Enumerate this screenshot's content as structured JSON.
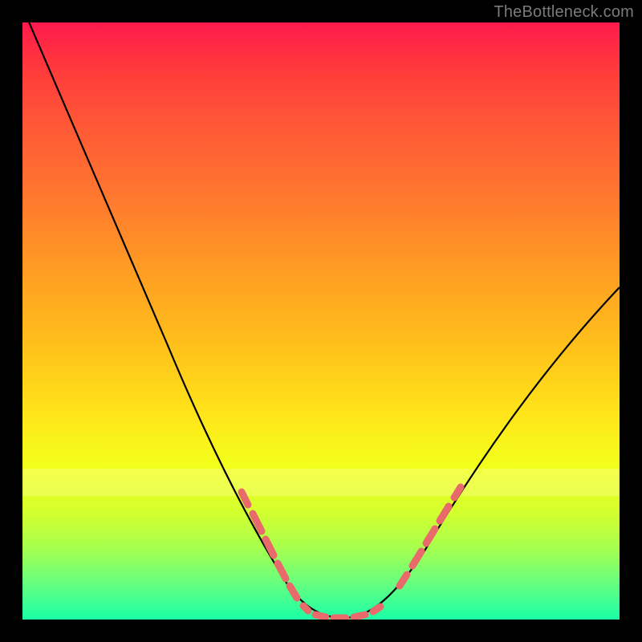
{
  "attribution": "TheBottleneck.com",
  "colors": {
    "curve_stroke": "#000000",
    "highlight_stroke": "#e86a6a",
    "background": "#000000"
  },
  "chart_data": {
    "type": "line",
    "title": "",
    "xlabel": "",
    "ylabel": "",
    "xlim": [
      0,
      100
    ],
    "ylim": [
      0,
      100
    ],
    "x": [
      0,
      5,
      10,
      15,
      20,
      25,
      30,
      35,
      40,
      45,
      48,
      50,
      52,
      55,
      58,
      60,
      65,
      70,
      75,
      80,
      85,
      90,
      95,
      100
    ],
    "values": [
      100,
      92,
      82,
      71,
      60,
      48,
      36,
      24,
      13,
      5,
      2,
      0.5,
      0,
      0.5,
      2,
      4,
      9,
      17,
      25,
      33,
      40,
      46,
      51,
      55
    ],
    "series": [
      {
        "name": "bottleneck-curve",
        "x": [
          0,
          5,
          10,
          15,
          20,
          25,
          30,
          35,
          40,
          45,
          48,
          50,
          52,
          55,
          58,
          60,
          65,
          70,
          75,
          80,
          85,
          90,
          95,
          100
        ],
        "values": [
          100,
          92,
          82,
          71,
          60,
          48,
          36,
          24,
          13,
          5,
          2,
          0.5,
          0,
          0.5,
          2,
          4,
          9,
          17,
          25,
          33,
          40,
          46,
          51,
          55
        ]
      }
    ],
    "annotations": [
      {
        "type": "highlight-segment",
        "x_range": [
          36,
          48
        ],
        "style": "dashed",
        "color": "#e86a6a"
      },
      {
        "type": "highlight-segment",
        "x_range": [
          48,
          58
        ],
        "style": "dashed",
        "color": "#e86a6a"
      },
      {
        "type": "highlight-segment",
        "x_range": [
          61,
          72
        ],
        "style": "dashed",
        "color": "#e86a6a"
      }
    ],
    "grid": false,
    "legend": false
  }
}
